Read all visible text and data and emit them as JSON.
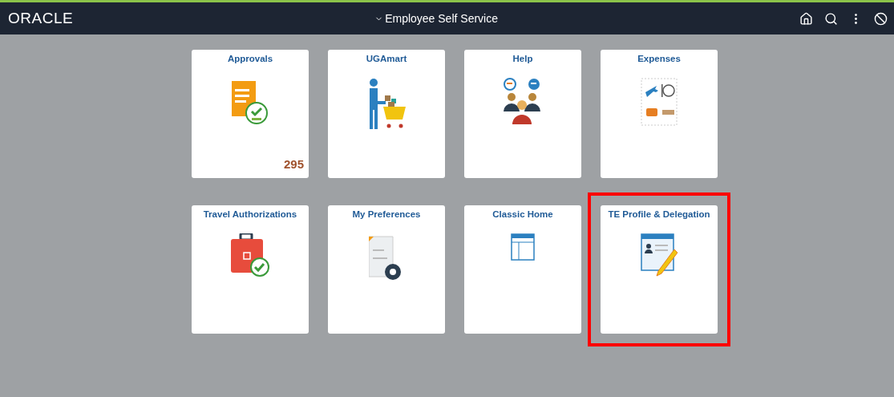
{
  "header": {
    "logo": "ORACLE",
    "title": "Employee Self Service"
  },
  "tiles": [
    {
      "title": "Approvals",
      "kind": "approvals",
      "badge": "295",
      "highlighted": false
    },
    {
      "title": "UGAmart",
      "kind": "shopping",
      "highlighted": false
    },
    {
      "title": "Help",
      "kind": "help",
      "highlighted": false
    },
    {
      "title": "Expenses",
      "kind": "expenses",
      "highlighted": false
    },
    {
      "title": "Travel Authorizations",
      "kind": "travel",
      "highlighted": false
    },
    {
      "title": "My Preferences",
      "kind": "preferences",
      "highlighted": false
    },
    {
      "title": "Classic Home",
      "kind": "classic",
      "highlighted": false
    },
    {
      "title": "TE Profile & Delegation",
      "kind": "profile",
      "highlighted": true
    }
  ]
}
